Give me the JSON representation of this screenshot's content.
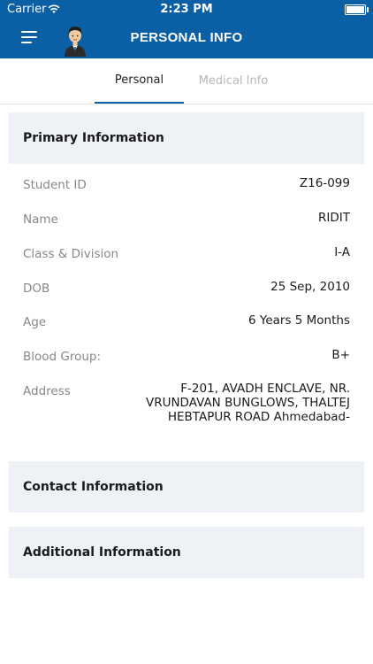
{
  "status": {
    "carrier": "Carrier",
    "time": "2:23 PM",
    "battery_level": 1.0
  },
  "navbar": {
    "title": "PERSONAL INFO",
    "menu_icon": "hamburger-icon",
    "avatar": "student-avatar"
  },
  "tabs": [
    {
      "label": "Personal",
      "active": true
    },
    {
      "label": "Medical Info",
      "active": false
    }
  ],
  "primary": {
    "title": "Primary Information",
    "fields": [
      {
        "label": "Student ID",
        "value": "Z16-099"
      },
      {
        "label": "Name",
        "value": "RIDIT"
      },
      {
        "label": "Class & Division",
        "value": "I-A"
      },
      {
        "label": "DOB",
        "value": "25 Sep, 2010"
      },
      {
        "label": "Age",
        "value": "6 Years 5 Months"
      },
      {
        "label": "Blood Group:",
        "value": "B+"
      }
    ],
    "address": {
      "label": "Address",
      "lines": [
        "F-201, AVADH ENCLAVE, NR.",
        "VRUNDAVAN BUNGLOWS, THALTEJ",
        "HEBTAPUR ROAD Ahmedabad-"
      ]
    }
  },
  "contact": {
    "title": "Contact Information"
  },
  "additional": {
    "title": "Additional Information"
  },
  "colors": {
    "brand": "#0b5fa5",
    "section_bg": "#eef2f6",
    "label": "#888888"
  }
}
